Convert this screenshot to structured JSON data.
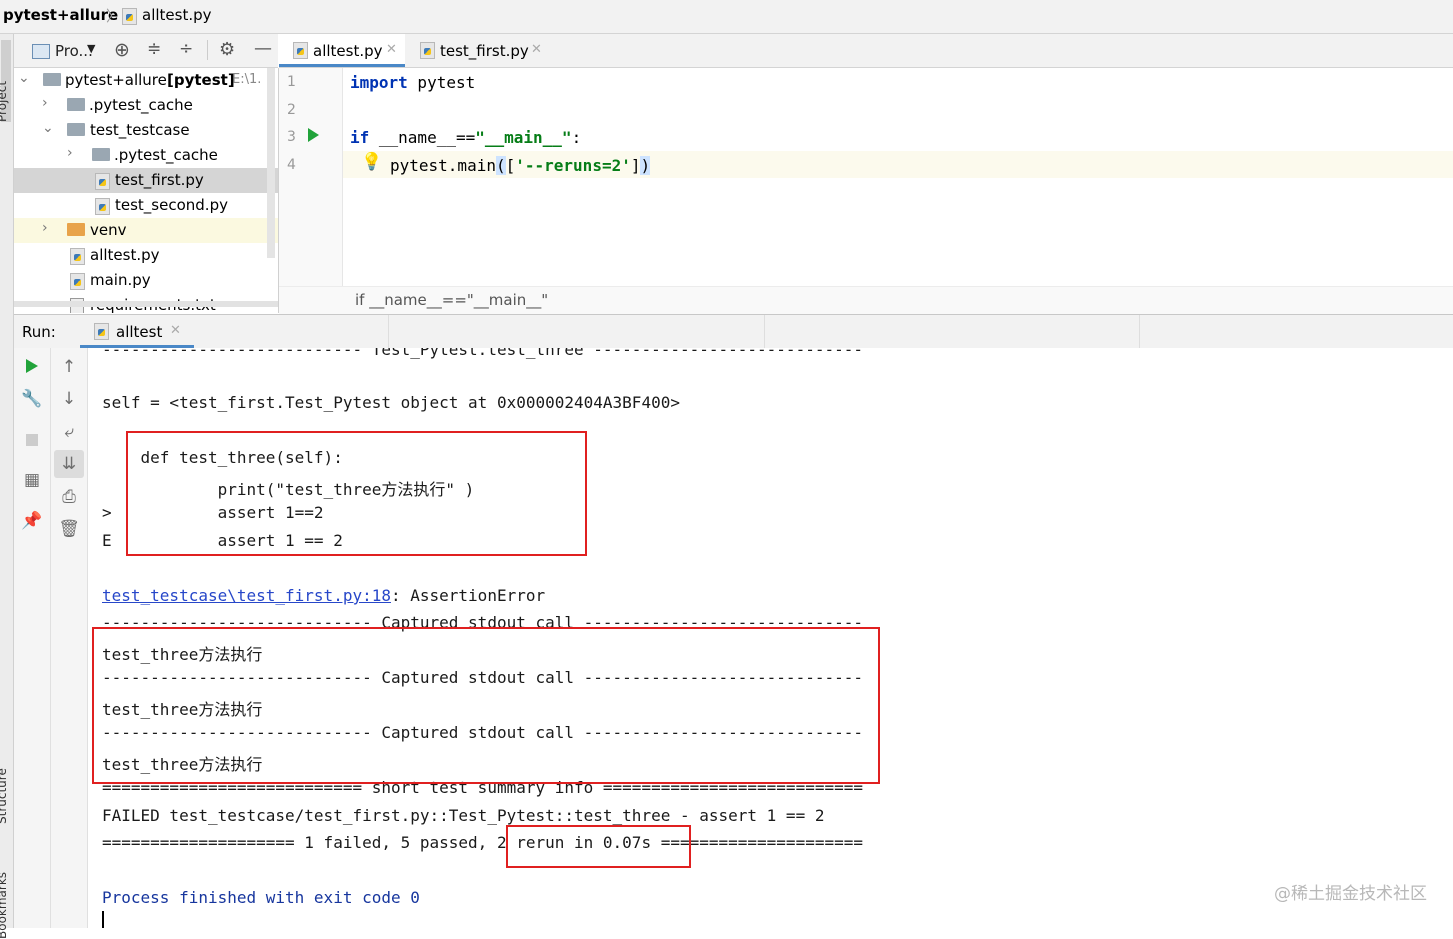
{
  "breadcrumb": {
    "project": "pytest+allure",
    "file": "alltest.py"
  },
  "left_strip": {
    "project": "Project",
    "structure": "Structure",
    "bookmarks": "Bookmarks"
  },
  "project_panel": {
    "title": "Pro...",
    "tree": [
      {
        "label": "pytest+allure",
        "bold_suffix": "[pytest]",
        "path_hint": "E:\\1.",
        "icon": "folder-icon",
        "expanded": true
      },
      {
        "label": ".pytest_cache",
        "icon": "folder-icon",
        "expanded": false
      },
      {
        "label": "test_testcase",
        "icon": "folder-icon",
        "expanded": true
      },
      {
        "label": ".pytest_cache",
        "icon": "folder-icon",
        "expanded": false
      },
      {
        "label": "test_first.py",
        "icon": "python-file-icon",
        "selected": true
      },
      {
        "label": "test_second.py",
        "icon": "python-file-icon"
      },
      {
        "label": "venv",
        "icon": "folder-icon",
        "expanded": false
      },
      {
        "label": "alltest.py",
        "icon": "python-file-icon"
      },
      {
        "label": "main.py",
        "icon": "python-file-icon"
      },
      {
        "label": "requirements.txt",
        "icon": "text-file-icon"
      }
    ]
  },
  "editor": {
    "tabs": [
      {
        "label": "alltest.py",
        "active": true
      },
      {
        "label": "test_first.py",
        "active": false
      }
    ],
    "line_numbers": [
      "1",
      "2",
      "3",
      "4"
    ],
    "code": {
      "l1_kw": "import",
      "l1_rest": " pytest",
      "l3_kw": "if",
      "l3_mid": " __name__==",
      "l3_str": "\"__main__\"",
      "l3_end": ":",
      "l4_a": "pytest.main",
      "l4_b": "(",
      "l4_c": "[",
      "l4_str": "'--reruns=2'",
      "l4_d": "]",
      "l4_e": ")"
    },
    "status_breadcrumb": "if __name__==\"__main__\""
  },
  "run": {
    "label": "Run:",
    "tab": "alltest",
    "console": {
      "l0": "--------------------------- Test_Pytest.test_three ----------------------------",
      "l1": "self = <test_first.Test_Pytest object at 0x000002404A3BF400>",
      "l2": "    def test_three(self):",
      "l3": "            print(\"test_three方法执行\" )",
      "l4": ">           assert 1==2",
      "l5": "E           assert 1 == 2",
      "l6_link": "test_testcase\\test_first.py:18",
      "l6_rest": ": AssertionError",
      "l7": "---------------------------- Captured stdout call -----------------------------",
      "l8": "test_three方法执行",
      "l9": "---------------------------- Captured stdout call -----------------------------",
      "l10": "test_three方法执行",
      "l11": "---------------------------- Captured stdout call -----------------------------",
      "l12": "test_three方法执行",
      "l13": "=========================== short test summary info ===========================",
      "l14": "FAILED test_testcase/test_first.py::Test_Pytest::test_three - assert 1 == 2",
      "l15": "==================== 1 failed, 5 passed, 2 rerun in 0.07s =====================",
      "l16": "Process finished with exit code 0"
    }
  },
  "watermark": "@稀土掘金技术社区"
}
